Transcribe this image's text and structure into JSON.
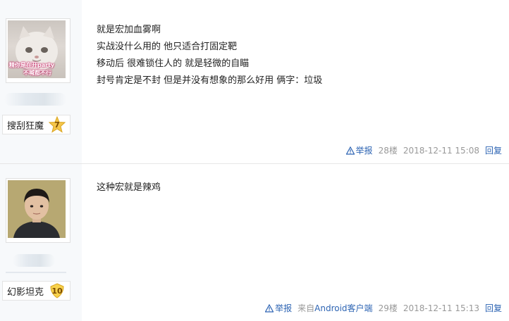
{
  "posts": [
    {
      "avatar_overlay": [
        "精你是在开party",
        "不喊都不行"
      ],
      "username": "搜刮狂魔",
      "level": "7",
      "content_lines": [
        "就是宏加血雾啊",
        "实战没什么用的 他只适合打固定靶",
        "移动后 很难锁住人的 就是轻微的自瞄",
        "封号肯定是不封 但是并没有想象的那么好用 俩字：垃圾"
      ],
      "report_label": "举报",
      "floor": "28楼",
      "time": "2018-12-11 15:08",
      "reply_label": "回复"
    },
    {
      "username": "幻影坦克",
      "level": "10",
      "content_lines": [
        "这种宏就是辣鸡"
      ],
      "report_label": "举报",
      "source_prefix": "来自",
      "source_app": "Android客户端",
      "floor": "29楼",
      "time": "2018-12-11 15:13",
      "reply_label": "回复"
    }
  ],
  "colors": {
    "link": "#2d64b3",
    "meta": "#999999",
    "sidebar_bg": "#f7f9fb",
    "level_7": "#f5c64a",
    "level_10": "#f8d24c"
  }
}
